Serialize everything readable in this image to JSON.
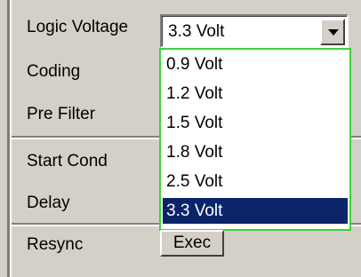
{
  "rows": {
    "logic_voltage": "Logic Voltage",
    "coding": "Coding",
    "pre_filter": "Pre Filter",
    "start_cond": "Start Cond",
    "delay": "Delay",
    "resync": "Resync"
  },
  "combo": {
    "value": "3.3 Volt",
    "options": [
      "0.9 Volt",
      "1.2 Volt",
      "1.5 Volt",
      "1.8 Volt",
      "2.5 Volt",
      "3.3 Volt"
    ],
    "selected_index": 5
  },
  "exec_label": "Exec",
  "icons": {
    "dropdown": "chevron-down-icon"
  },
  "colors": {
    "panel": "#d4d0c8",
    "selection": "#0a246a",
    "focus_border": "#3cd23c"
  }
}
